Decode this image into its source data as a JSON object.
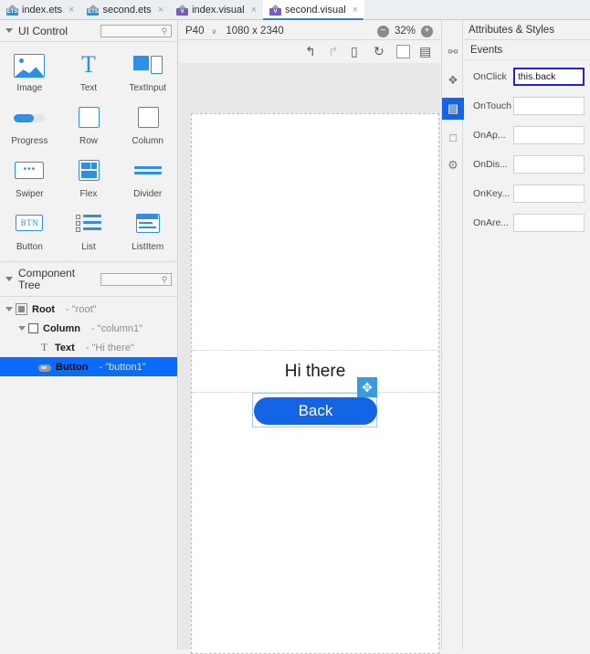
{
  "tabs": [
    {
      "label": "index.ets",
      "icon": "ets-file-icon",
      "glyph": "ETS",
      "active": false,
      "close": "×"
    },
    {
      "label": "second.ets",
      "icon": "ets-file-icon",
      "glyph": "ETS",
      "active": false,
      "close": "×"
    },
    {
      "label": "index.visual",
      "icon": "visual-file-icon",
      "glyph": "V",
      "active": false,
      "close": "×"
    },
    {
      "label": "second.visual",
      "icon": "visual-file-icon",
      "glyph": "V",
      "active": true,
      "close": "×"
    }
  ],
  "ui_control": {
    "title": "UI Control",
    "search_placeholder": "",
    "search_value": "",
    "items": [
      {
        "label": "Image",
        "icon": "image-icon"
      },
      {
        "label": "Text",
        "icon": "text-icon",
        "glyph": "T"
      },
      {
        "label": "TextInput",
        "icon": "textinput-icon"
      },
      {
        "label": "Progress",
        "icon": "progress-icon"
      },
      {
        "label": "Row",
        "icon": "row-icon"
      },
      {
        "label": "Column",
        "icon": "column-icon"
      },
      {
        "label": "Swiper",
        "icon": "swiper-icon"
      },
      {
        "label": "Flex",
        "icon": "flex-icon"
      },
      {
        "label": "Divider",
        "icon": "divider-icon"
      },
      {
        "label": "Button",
        "icon": "button-icon",
        "glyph": "BTN"
      },
      {
        "label": "List",
        "icon": "list-icon"
      },
      {
        "label": "ListItem",
        "icon": "listitem-icon"
      }
    ]
  },
  "component_tree": {
    "title": "Component Tree",
    "search_value": "",
    "rows": [
      {
        "name": "Root",
        "value": "- \"root\"",
        "icon": "root-icon",
        "depth": 0,
        "expanded": true,
        "selected": false
      },
      {
        "name": "Column",
        "value": "- \"column1\"",
        "icon": "column-icon",
        "depth": 1,
        "expanded": true,
        "selected": false
      },
      {
        "name": "Text",
        "value": "- \"Hi there\"",
        "icon": "text-icon",
        "depth": 2,
        "expanded": false,
        "selected": false
      },
      {
        "name": "Button",
        "value": "- \"button1\"",
        "icon": "button-icon",
        "depth": 2,
        "expanded": false,
        "selected": true
      }
    ]
  },
  "canvas_toolbar": {
    "device": "P40",
    "device_caret": "∨",
    "resolution": "1080 x 2340",
    "zoom_out": "−",
    "zoom_level": "32%",
    "zoom_in": "+",
    "actions": [
      {
        "icon": "undo-icon",
        "glyph": "↰",
        "enabled": true
      },
      {
        "icon": "redo-icon",
        "glyph": "↱",
        "enabled": false
      },
      {
        "icon": "device-preview-icon",
        "glyph": "▯",
        "enabled": true
      },
      {
        "icon": "rotate-icon",
        "glyph": "↻",
        "enabled": true
      },
      {
        "icon": "frame-icon",
        "glyph": "",
        "enabled": true
      },
      {
        "icon": "layout-grid-icon",
        "glyph": "▤",
        "enabled": true
      }
    ]
  },
  "preview": {
    "text_label": "Hi there",
    "button_label": "Back",
    "move_handle": "✥"
  },
  "rail": [
    {
      "icon": "components-icon",
      "glyph": "⚯",
      "active": false
    },
    {
      "icon": "puzzle-icon",
      "glyph": "❖",
      "active": false
    },
    {
      "icon": "events-icon",
      "glyph": "▤",
      "active": true
    },
    {
      "icon": "frame-icon",
      "glyph": "□",
      "active": false
    },
    {
      "icon": "settings-icon",
      "glyph": "⚙",
      "active": false
    }
  ],
  "attributes_panel": {
    "title": "Attributes & Styles",
    "section": "Events",
    "events": [
      {
        "label": "OnClick",
        "value": "this.back",
        "focused": true
      },
      {
        "label": "OnTouch",
        "value": "",
        "focused": false
      },
      {
        "label": "OnAp...",
        "value": "",
        "focused": false
      },
      {
        "label": "OnDis...",
        "value": "",
        "focused": false
      },
      {
        "label": "OnKey...",
        "value": "",
        "focused": false
      },
      {
        "label": "OnAre...",
        "value": "",
        "focused": false
      }
    ]
  },
  "colors": {
    "accent_blue": "#1464e6",
    "selection_blue": "#0a6cff",
    "icon_blue": "#2f8fe8",
    "focus_border": "#2222dd",
    "handle_blue": "#3a9be0"
  }
}
